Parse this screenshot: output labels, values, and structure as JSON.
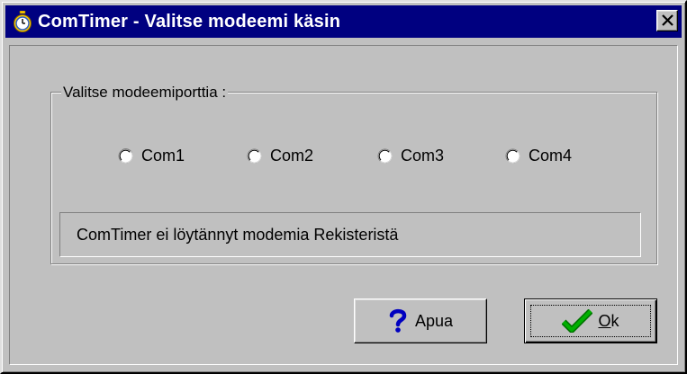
{
  "window": {
    "title": "ComTimer - Valitse modeemi käsin",
    "title_icon": "stopwatch-icon",
    "close_icon": "close-icon",
    "titlebar_color": "#000080",
    "background_color": "#c0c0c0"
  },
  "group": {
    "label": "Valitse modeemiporttia :",
    "ports": [
      {
        "label": "Com1",
        "selected": false
      },
      {
        "label": "Com2",
        "selected": false
      },
      {
        "label": "Com3",
        "selected": false
      },
      {
        "label": "Com4",
        "selected": false
      }
    ]
  },
  "status": {
    "text": "ComTimer ei löytännyt modemia Rekisteristä"
  },
  "buttons": {
    "help": {
      "label": "Apua",
      "icon": "question-mark-icon"
    },
    "ok": {
      "label_underlined": "O",
      "label_rest": "k",
      "icon": "checkmark-icon",
      "default": true
    }
  }
}
